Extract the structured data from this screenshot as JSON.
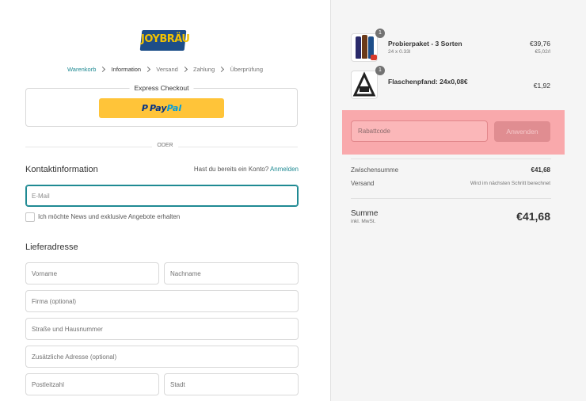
{
  "logo": {
    "wordmark": "JOYBRÄU"
  },
  "breadcrumb": {
    "cart": "Warenkorb",
    "information": "Information",
    "shipping": "Versand",
    "payment": "Zahlung",
    "review": "Überprüfung"
  },
  "express": {
    "title": "Express Checkout",
    "paypal_p": "Pay",
    "paypal_pal": "Pal"
  },
  "divider": {
    "label": "ODER"
  },
  "contact": {
    "title": "Kontaktinformation",
    "have_account": "Hast du bereits ein Konto?",
    "login_link": "Anmelden",
    "email_placeholder": "E-Mail",
    "newsletter_label": "Ich möchte News und exklusive Angebote erhalten"
  },
  "address": {
    "title": "Lieferadresse",
    "first_name": "Vorname",
    "last_name": "Nachname",
    "company": "Firma (optional)",
    "street": "Straße und Hausnummer",
    "additional": "Zusätzliche Adresse (optional)",
    "postcode": "Postleitzahl",
    "city": "Stadt"
  },
  "cart": {
    "items": [
      {
        "quantity": "1",
        "name": "Probierpaket - 3 Sorten",
        "variant": "24 x 0.33l",
        "price": "€39,76",
        "unit_price": "€5,02/l"
      },
      {
        "quantity": "1",
        "name": "Flaschenpfand: 24x0,08€",
        "variant": "",
        "price": "€1,92",
        "unit_price": ""
      }
    ],
    "discount_placeholder": "Rabattcode",
    "apply_label": "Anwenden",
    "subtotal_label": "Zwischensumme",
    "subtotal_value": "€41,68",
    "shipping_label": "Versand",
    "shipping_value": "Wird im nächsten Schritt berechnet",
    "total_label": "Summe",
    "total_sub": "inkl. MwSt.",
    "total_value": "€41,68"
  },
  "colors": {
    "accent": "#1f8a93",
    "paypal_yellow": "#ffc439",
    "highlight": "#f9a9ac",
    "brand_blue": "#1d4e89"
  }
}
